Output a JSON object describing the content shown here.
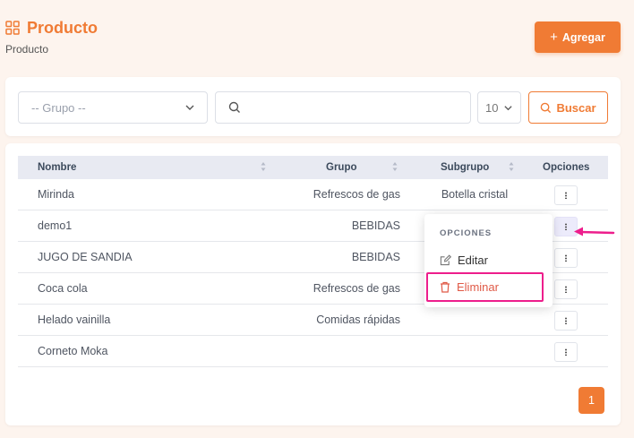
{
  "header": {
    "title": "Producto",
    "breadcrumb": "Producto",
    "icon": "grid-icon"
  },
  "toolbar": {
    "add_label": "Agregar"
  },
  "filters": {
    "group_placeholder": "-- Grupo --",
    "search_value": "",
    "page_size": "10",
    "search_button": "Buscar"
  },
  "table": {
    "columns": [
      "Nombre",
      "Grupo",
      "Subgrupo",
      "Opciones"
    ],
    "rows": [
      {
        "nombre": "Mirinda",
        "grupo": "Refrescos de gas",
        "subgrupo": "Botella cristal"
      },
      {
        "nombre": "demo1",
        "grupo": "BEBIDAS",
        "subgrupo": ""
      },
      {
        "nombre": "JUGO DE SANDIA",
        "grupo": "BEBIDAS",
        "subgrupo": ""
      },
      {
        "nombre": "Coca cola",
        "grupo": "Refrescos de gas",
        "subgrupo": ""
      },
      {
        "nombre": "Helado vainilla",
        "grupo": "Comidas rápidas",
        "subgrupo": ""
      },
      {
        "nombre": "Corneto Moka",
        "grupo": "",
        "subgrupo": ""
      }
    ]
  },
  "dropdown": {
    "heading": "OPCIONES",
    "edit": "Editar",
    "delete": "Eliminar"
  },
  "pagination": {
    "current": "1"
  },
  "colors": {
    "accent": "#f07b34",
    "highlight": "#ed1e8c",
    "danger": "#e05a47",
    "background": "#fdf4ee"
  }
}
